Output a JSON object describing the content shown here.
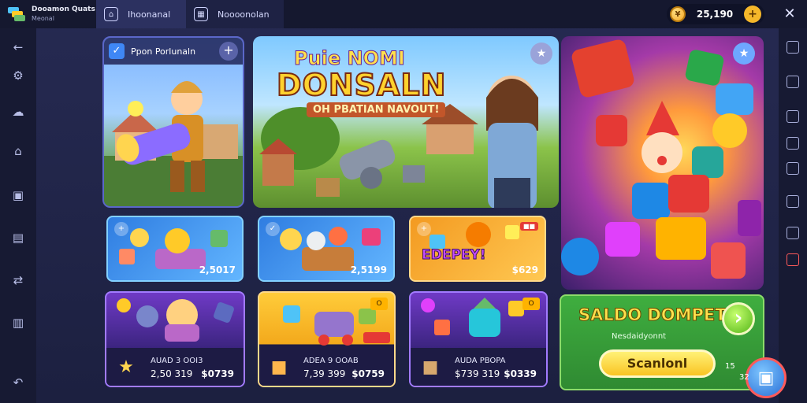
{
  "app": {
    "name": "Dooamon Quats",
    "sub": "Meonal"
  },
  "tabs": [
    {
      "label": "Ihoonanal",
      "icon": "home-icon"
    },
    {
      "label": "Noooonolan",
      "icon": "image-icon"
    }
  ],
  "wallet_balance": {
    "value": "25,190",
    "add_label": "+"
  },
  "colors": {
    "accent": "#3f87f5",
    "coin": "#f5a623",
    "wallet": "#3fae3f"
  },
  "hero1": {
    "title": "Ppon Porlunaln",
    "plus": "+",
    "check": "✓"
  },
  "hero2": {
    "line1": "Puie NOMI",
    "line2": "DONSALN",
    "line3": "OH PBATIAN NAVOUT!"
  },
  "small_cards": [
    {
      "price": "2,5017"
    },
    {
      "price": "2,5199"
    },
    {
      "word": "EDEPEY!",
      "price": "$629"
    }
  ],
  "bottom_cards": [
    {
      "title": "AUAD 3 OOI3",
      "price1": "2,50 319",
      "price2": "$0739"
    },
    {
      "title": "ADEA 9 OOAB",
      "price1": "7,39 399",
      "price2": "$0759",
      "tag": "O"
    },
    {
      "title": "AUDA PBOPA",
      "price1": "$739 319",
      "price2": "$0339",
      "tag": "O"
    }
  ],
  "wallet": {
    "title": "SALDO DOMPET",
    "arrow": "›",
    "sub": "Nesdaidyonnt",
    "button": "Scanlonl",
    "count": "15"
  },
  "fab_label": "32"
}
